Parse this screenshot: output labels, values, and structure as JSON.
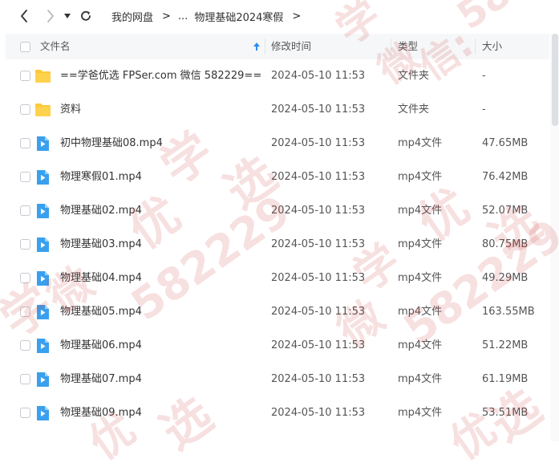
{
  "toolbar": {
    "back_icon": "chevron-left-icon",
    "forward_icon": "chevron-right-icon",
    "dropdown_icon": "caret-down-icon",
    "refresh_icon": "refresh-icon"
  },
  "breadcrumb": {
    "root": "我的网盘",
    "sep1": ">",
    "ellipsis": "...",
    "current": "物理基础2024寒假",
    "sep2": ">"
  },
  "table": {
    "headers": {
      "name": "文件名",
      "modified": "修改时间",
      "type": "类型",
      "size": "大小"
    },
    "sort_icon": "sort-up-arrow-icon",
    "rows": [
      {
        "name": "==学爸优选 FPSer.com 微信 582229==",
        "time": "2024-05-10 11:53",
        "type": "文件夹",
        "size": "-",
        "icon": "folder"
      },
      {
        "name": "资料",
        "time": "2024-05-10 11:53",
        "type": "文件夹",
        "size": "-",
        "icon": "folder"
      },
      {
        "name": "初中物理基础08.mp4",
        "time": "2024-05-10 11:53",
        "type": "mp4文件",
        "size": "47.65MB",
        "icon": "video"
      },
      {
        "name": "物理寒假01.mp4",
        "time": "2024-05-10 11:53",
        "type": "mp4文件",
        "size": "76.42MB",
        "icon": "video"
      },
      {
        "name": "物理基础02.mp4",
        "time": "2024-05-10 11:53",
        "type": "mp4文件",
        "size": "52.07MB",
        "icon": "video"
      },
      {
        "name": "物理基础03.mp4",
        "time": "2024-05-10 11:53",
        "type": "mp4文件",
        "size": "80.75MB",
        "icon": "video"
      },
      {
        "name": "物理基础04.mp4",
        "time": "2024-05-10 11:53",
        "type": "mp4文件",
        "size": "49.29MB",
        "icon": "video"
      },
      {
        "name": "物理基础05.mp4",
        "time": "2024-05-10 11:53",
        "type": "mp4文件",
        "size": "163.55MB",
        "icon": "video"
      },
      {
        "name": "物理基础06.mp4",
        "time": "2024-05-10 11:53",
        "type": "mp4文件",
        "size": "51.22MB",
        "icon": "video"
      },
      {
        "name": "物理基础07.mp4",
        "time": "2024-05-10 11:53",
        "type": "mp4文件",
        "size": "61.19MB",
        "icon": "video"
      },
      {
        "name": "物理基础09.mp4",
        "time": "2024-05-10 11:53",
        "type": "mp4文件",
        "size": "53.51MB",
        "icon": "video"
      }
    ]
  },
  "watermark": {
    "chars": [
      "学",
      "爸",
      "优",
      "选",
      "微",
      "信"
    ],
    "number": "582229",
    "color": "#cd4141"
  },
  "colors": {
    "folder": "#fcc93a",
    "video": "#3aa0ee",
    "accent": "#2b8cf0"
  }
}
